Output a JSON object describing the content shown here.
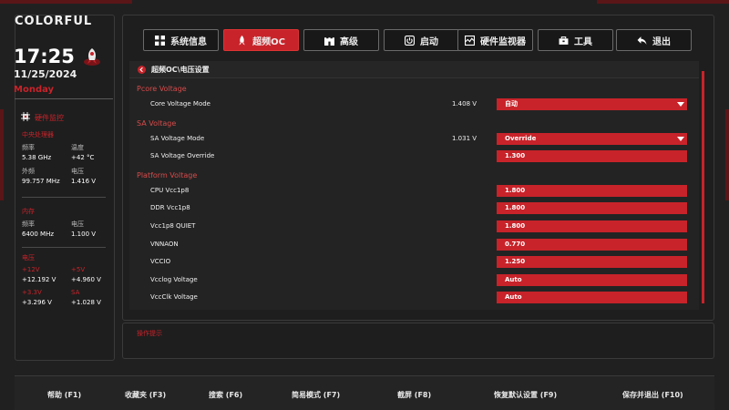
{
  "brand": "COLORFUL",
  "clock": {
    "time": "17:25",
    "date": "11/25/2024",
    "weekday": "Monday"
  },
  "hw": {
    "title": "硬件监控",
    "cpu": {
      "title": "中央处理器",
      "freq_label": "频率",
      "freq": "5.38 GHz",
      "temp_label": "温度",
      "temp": "+42 °C",
      "bclk_label": "外频",
      "bclk": "99.757 MHz",
      "volt_label": "电压",
      "volt": "1.416 V"
    },
    "memory": {
      "title": "内存",
      "freq_label": "频率",
      "freq": "6400 MHz",
      "volt_label": "电压",
      "volt": "1.100 V"
    },
    "voltage": {
      "title": "电压",
      "v12_label": "+12V",
      "v12": "+12.192 V",
      "v5_label": "+5V",
      "v5": "+4.960 V",
      "v33_label": "+3.3V",
      "v33": "+3.296 V",
      "sa_label": "SA",
      "sa": "+1.028 V"
    }
  },
  "tabs": [
    {
      "label": "系统信息",
      "icon": "grid-icon"
    },
    {
      "label": "超频OC",
      "icon": "rocket-icon"
    },
    {
      "label": "高级",
      "icon": "castle-icon"
    },
    {
      "label": "启动",
      "icon": "power-icon"
    },
    {
      "label": "硬件监视器",
      "icon": "monitor-icon"
    },
    {
      "label": "工具",
      "icon": "toolbox-icon"
    },
    {
      "label": "退出",
      "icon": "back-arrow-icon"
    }
  ],
  "breadcrumb": "超频OC\\电压设置",
  "sections": {
    "pcore": "Pcore Voltage",
    "sa": "SA Voltage",
    "platform": "Platform Voltage"
  },
  "rows": {
    "core_mode": {
      "label": "Core Voltage Mode",
      "current": "1.408 V",
      "value": "自动"
    },
    "sa_mode": {
      "label": "SA Voltage Mode",
      "current": "1.031 V",
      "value": "Override"
    },
    "sa_override": {
      "label": "SA Voltage Override",
      "value": "1.300"
    },
    "cpu_vcc1p8": {
      "label": "CPU Vcc1p8",
      "value": "1.800"
    },
    "ddr_vcc1p8": {
      "label": "DDR Vcc1p8",
      "value": "1.800"
    },
    "vcc1p8_quiet": {
      "label": "Vcc1p8 QUIET",
      "value": "1.800"
    },
    "vnnaon": {
      "label": "VNNAON",
      "value": "0.770"
    },
    "vccio": {
      "label": "VCCIO",
      "value": "1.250"
    },
    "vcclog": {
      "label": "Vcclog Voltage",
      "value": "Auto"
    },
    "vccclk": {
      "label": "VccClk Voltage",
      "value": "Auto"
    }
  },
  "tips_title": "操作提示",
  "fkeys": [
    "帮助 (F1)",
    "收藏夹 (F3)",
    "搜索 (F6)",
    "简易模式 (F7)",
    "截屏 (F8)",
    "恢复默认设置 (F9)",
    "保存并退出 (F10)"
  ],
  "colors": {
    "accent": "#c8232a",
    "background": "#202020"
  }
}
